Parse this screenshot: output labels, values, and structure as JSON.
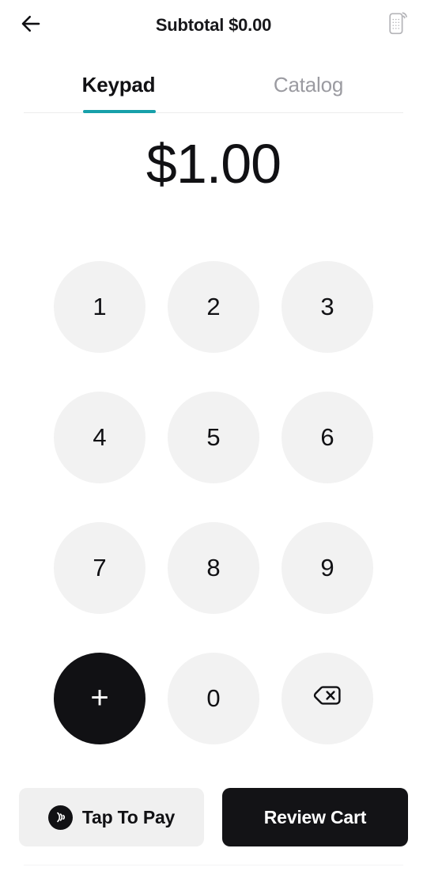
{
  "header": {
    "back_icon": "arrow-left-icon",
    "title": "Subtotal $0.00",
    "reader_icon": "card-reader-icon"
  },
  "tabs": {
    "items": [
      {
        "label": "Keypad",
        "active": true
      },
      {
        "label": "Catalog",
        "active": false
      }
    ],
    "indicator_color": "#17a0aa"
  },
  "amount": {
    "value": "$1.00"
  },
  "keypad": {
    "keys": [
      {
        "label": "1",
        "name": "key-1",
        "style": "light"
      },
      {
        "label": "2",
        "name": "key-2",
        "style": "light"
      },
      {
        "label": "3",
        "name": "key-3",
        "style": "light"
      },
      {
        "label": "4",
        "name": "key-4",
        "style": "light"
      },
      {
        "label": "5",
        "name": "key-5",
        "style": "light"
      },
      {
        "label": "6",
        "name": "key-6",
        "style": "light"
      },
      {
        "label": "7",
        "name": "key-7",
        "style": "light"
      },
      {
        "label": "8",
        "name": "key-8",
        "style": "light"
      },
      {
        "label": "9",
        "name": "key-9",
        "style": "light"
      },
      {
        "label": "+",
        "name": "key-add",
        "style": "dark"
      },
      {
        "label": "0",
        "name": "key-0",
        "style": "light"
      },
      {
        "label": "",
        "name": "key-backspace",
        "style": "light",
        "icon": "backspace-icon"
      }
    ],
    "key_bg": "#f2f2f2",
    "key_dark_bg": "#111114"
  },
  "actions": {
    "tap_to_pay": {
      "label": "Tap To Pay",
      "icon": "contactless-payment-icon",
      "bg": "#f0f0f0"
    },
    "review_cart": {
      "label": "Review Cart",
      "bg": "#131316"
    }
  }
}
